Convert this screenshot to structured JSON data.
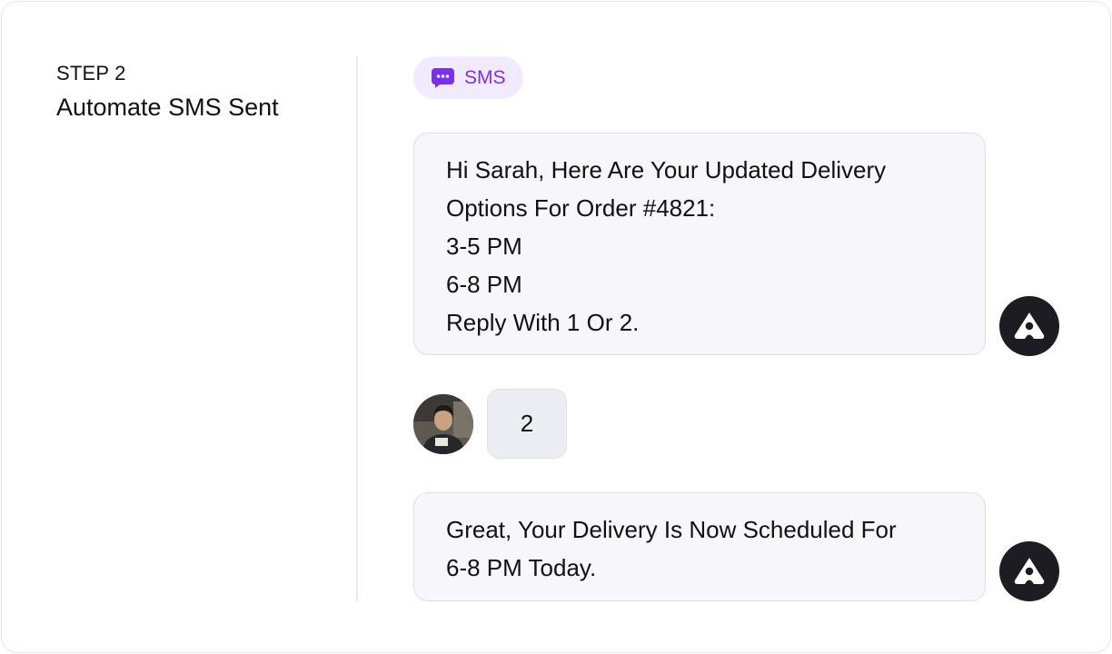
{
  "step": {
    "label": "STEP 2",
    "title": "Automate SMS Sent"
  },
  "channel": {
    "label": "SMS",
    "icon": "message-dots-icon",
    "accent_color": "#7b2ff2",
    "chip_background": "#f2eafe"
  },
  "messages": [
    {
      "sender": "bot",
      "lines": [
        "Hi Sarah, Here Are Your Updated Delivery",
        "Options For Order #4821:",
        "3-5 PM",
        "6-8 PM",
        "Reply With 1 Or 2."
      ]
    },
    {
      "sender": "user",
      "text": "2"
    },
    {
      "sender": "bot",
      "lines": [
        "Great, Your Delivery Is Now Scheduled For",
        "6-8 PM Today."
      ]
    }
  ]
}
